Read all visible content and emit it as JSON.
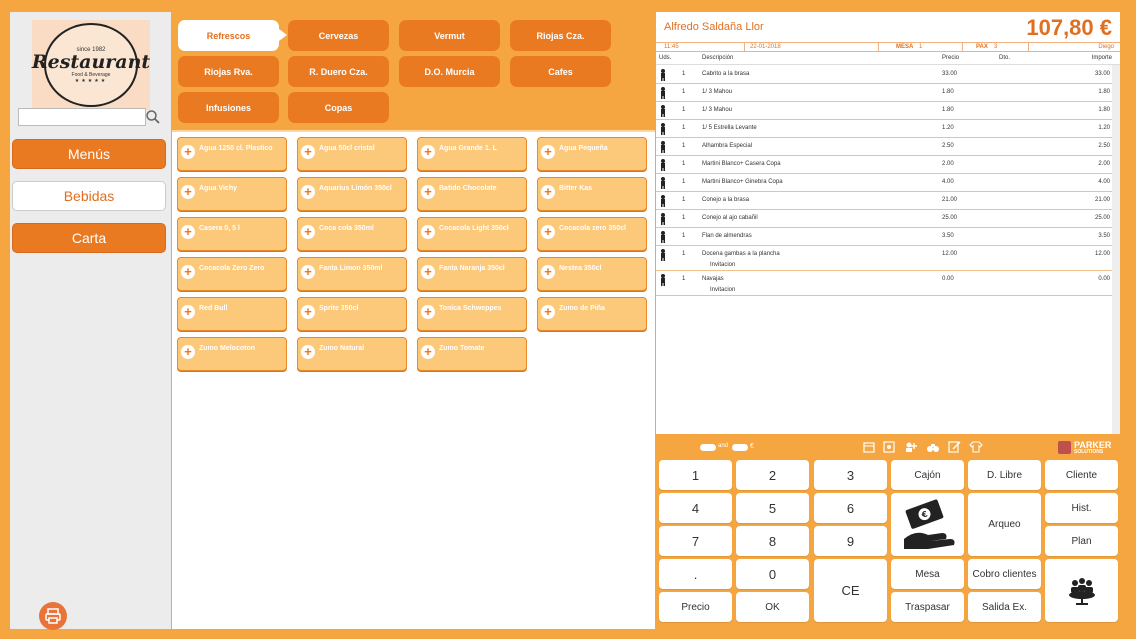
{
  "brand": {
    "logo_since": "since 1982",
    "logo_word": "Restaurant",
    "logo_tag": "Food & Beverage",
    "logo_stars": "★★★★★"
  },
  "search": {
    "value": "",
    "placeholder": ""
  },
  "sidebar": {
    "items": [
      {
        "label": "Menús"
      },
      {
        "label": "Bebidas"
      },
      {
        "label": "Carta"
      }
    ]
  },
  "categories": [
    {
      "label": "Refrescos"
    },
    {
      "label": "Cervezas"
    },
    {
      "label": "Vermut"
    },
    {
      "label": "Riojas Cza."
    },
    {
      "label": "Riojas Rva."
    },
    {
      "label": "R. Duero Cza."
    },
    {
      "label": "D.O. Murcia"
    },
    {
      "label": "Cafes"
    },
    {
      "label": "Infusiones"
    },
    {
      "label": "Copas"
    }
  ],
  "products": [
    "Agua 1250 cl. Plastico",
    "Agua 50cl cristal",
    "Agua Grande 1. L",
    "Agua Pequeña",
    "Agua Vichy",
    "Aquarius Limón 350cl",
    "Batido Chocolate",
    "Bitter Kas",
    "Casera 0, 5 l",
    "Coca cola 350ml",
    "Cocacola Light 350cl",
    "Cocacola zero 350cl",
    "Cocacola Zero Zero",
    "Fanta Limon 350ml",
    "Fanta Naranja 350cl",
    "Nestea 350cl",
    "Red Bull",
    "Sprite 350cl",
    "Tonica Schweppes",
    "Zumo de Piña",
    "Zumo Melocoton",
    "Zumo Natural",
    "Zumo Tomate"
  ],
  "ticket": {
    "client": "Alfredo Saldaña Llor",
    "total": "107,80 €",
    "time": "11:45",
    "date": "22-01-2018",
    "mesa_label": "MESA",
    "mesa_value": "1",
    "pax_label": "PAX",
    "pax_value": "3",
    "waiter": "Diego",
    "columns": {
      "uds": "Uds.",
      "desc": "Descripción",
      "precio": "Precio",
      "dto": "Dto.",
      "importe": "Importe"
    },
    "rows": [
      {
        "qty": "1",
        "desc": "Cabrito a la brasa",
        "price": "33.00",
        "amount": "33.00"
      },
      {
        "qty": "1",
        "desc": "1/ 3 Mahou",
        "price": "1.80",
        "amount": "1.80"
      },
      {
        "qty": "1",
        "desc": "1/ 3 Mahou",
        "price": "1.80",
        "amount": "1.80"
      },
      {
        "qty": "1",
        "desc": "1/ 5 Estrella Levante",
        "price": "1.20",
        "amount": "1.20"
      },
      {
        "qty": "1",
        "desc": "Alhambra Especial",
        "price": "2.50",
        "amount": "2.50"
      },
      {
        "qty": "1",
        "desc": "Martini Blanco+ Casera Copa",
        "price": "2.00",
        "amount": "2.00"
      },
      {
        "qty": "1",
        "desc": "Martini Blanco+ Ginebra Copa",
        "price": "4.00",
        "amount": "4.00"
      },
      {
        "qty": "1",
        "desc": "Conejo a la brasa",
        "price": "21.00",
        "amount": "21.00"
      },
      {
        "qty": "1",
        "desc": "Conejo al ajo cabañil",
        "price": "25.00",
        "amount": "25.00"
      },
      {
        "qty": "1",
        "desc": "Flan de almendras",
        "price": "3.50",
        "amount": "3.50"
      },
      {
        "qty": "1",
        "desc": "Docena gambas a la plancha",
        "price": "12.00",
        "amount": "12.00",
        "note": "Invitacion"
      },
      {
        "qty": "1",
        "desc": "Navajas",
        "price": "0.00",
        "amount": "0.00",
        "note": "Invitacion"
      }
    ]
  },
  "toolbar": {
    "and_label": "and",
    "euro_label": "€",
    "brand_name": "PARKER",
    "brand_sub": "SOLUTIONS"
  },
  "keys": {
    "k1": "1",
    "k2": "2",
    "k3": "3",
    "k4": "4",
    "k5": "5",
    "k6": "6",
    "k7": "7",
    "k8": "8",
    "k9": "9",
    "kdot": ".",
    "k0": "0",
    "kce": "CE",
    "precio": "Precio",
    "ok": "OK",
    "cajon": "Cajón",
    "dlibre": "D. Libre",
    "cliente": "Cliente",
    "hist": "Hist.",
    "arqueo": "Arqueo",
    "plan": "Plan",
    "mesa": "Mesa",
    "cobro": "Cobro clientes",
    "traspasar": "Traspasar",
    "salida": "Salida Ex."
  },
  "colors": {
    "accent": "#ea7a22",
    "background": "#f5a640",
    "product_fill": "#fcc87a"
  }
}
